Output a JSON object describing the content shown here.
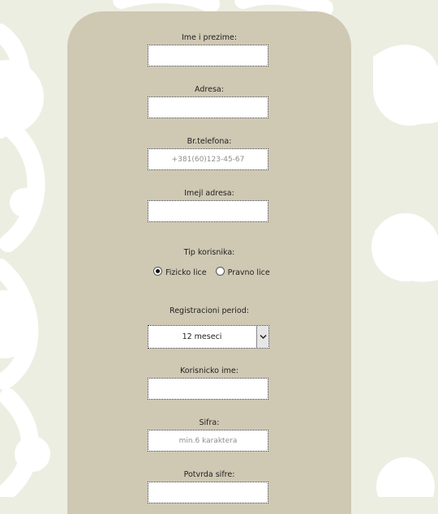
{
  "form": {
    "full_name": {
      "label": "Ime i prezime:",
      "value": "",
      "placeholder": ""
    },
    "address": {
      "label": "Adresa:",
      "value": "",
      "placeholder": ""
    },
    "phone": {
      "label": "Br.telefona:",
      "value": "",
      "placeholder": "+381(60)123-45-67"
    },
    "email": {
      "label": "Imejl adresa:",
      "value": "",
      "placeholder": ""
    },
    "user_type": {
      "label": "Tip korisnika:",
      "options": [
        {
          "label": "Fizicko lice",
          "checked": true
        },
        {
          "label": "Pravno lice",
          "checked": false
        }
      ]
    },
    "period": {
      "label": "Registracioni period:",
      "selected": "12 meseci"
    },
    "username": {
      "label": "Korisnicko ime:",
      "value": "",
      "placeholder": ""
    },
    "password": {
      "label": "Sifra:",
      "value": "",
      "placeholder": "min.6 karaktera"
    },
    "password_confirm": {
      "label": "Potvrda sifre:",
      "value": "",
      "placeholder": ""
    }
  },
  "colors": {
    "page_background": "#eceee2",
    "decoration": "#ffffff",
    "card_background": "#cfc8b3"
  },
  "icons": [
    "chevron-down-icon"
  ]
}
